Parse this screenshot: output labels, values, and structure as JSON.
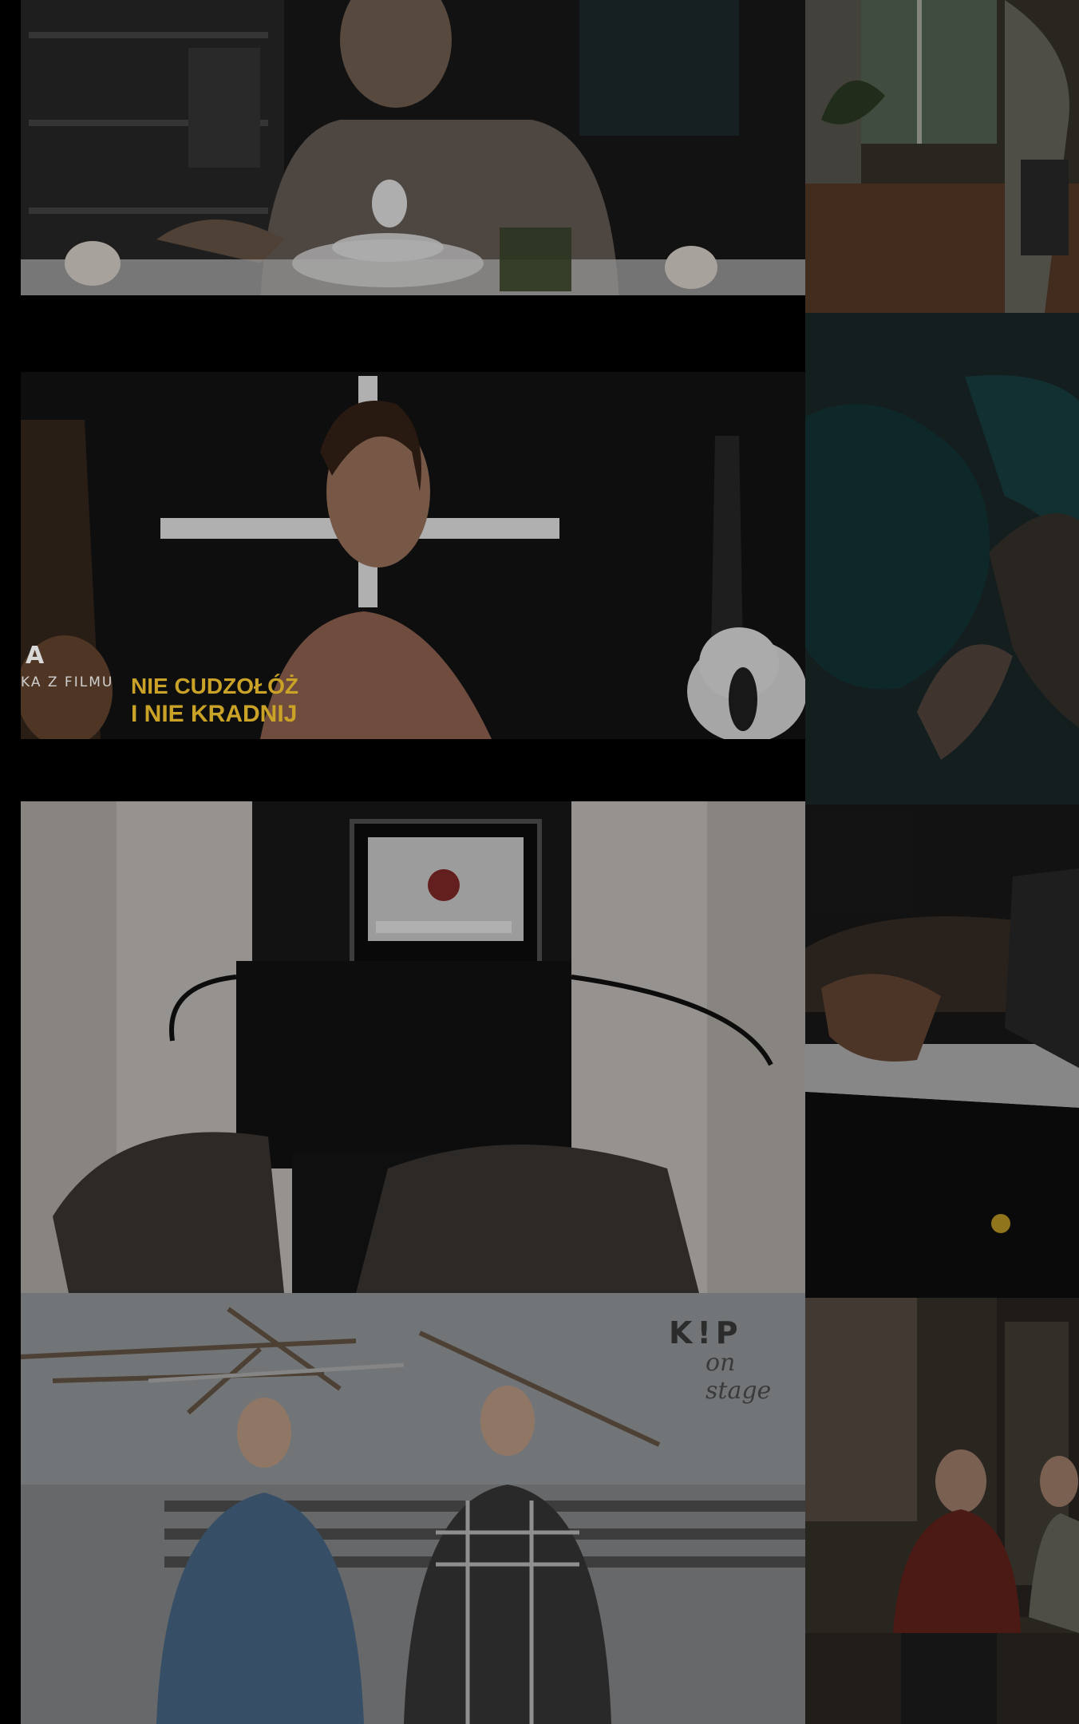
{
  "gallery": {
    "tiles": [
      {
        "name": "man-egg-breakfast"
      },
      {
        "name": "room-window-chair"
      },
      {
        "name": "woman-cross-guitar",
        "caption_letter": "A",
        "caption_sub": "KA Z FILMU",
        "title_line1": "NIE CUDZOŁÓŻ",
        "title_line2": "I NIE KRADNIJ"
      },
      {
        "name": "dark-blue-hand"
      },
      {
        "name": "camera-rig"
      },
      {
        "name": "hand-piano"
      },
      {
        "name": "kip-on-stage",
        "logo": "K!P",
        "logo_sub": "on stage"
      },
      {
        "name": "man-red-shirt-room"
      }
    ]
  },
  "colors": {
    "background": "#000000",
    "title_accent": "#c9a227"
  }
}
